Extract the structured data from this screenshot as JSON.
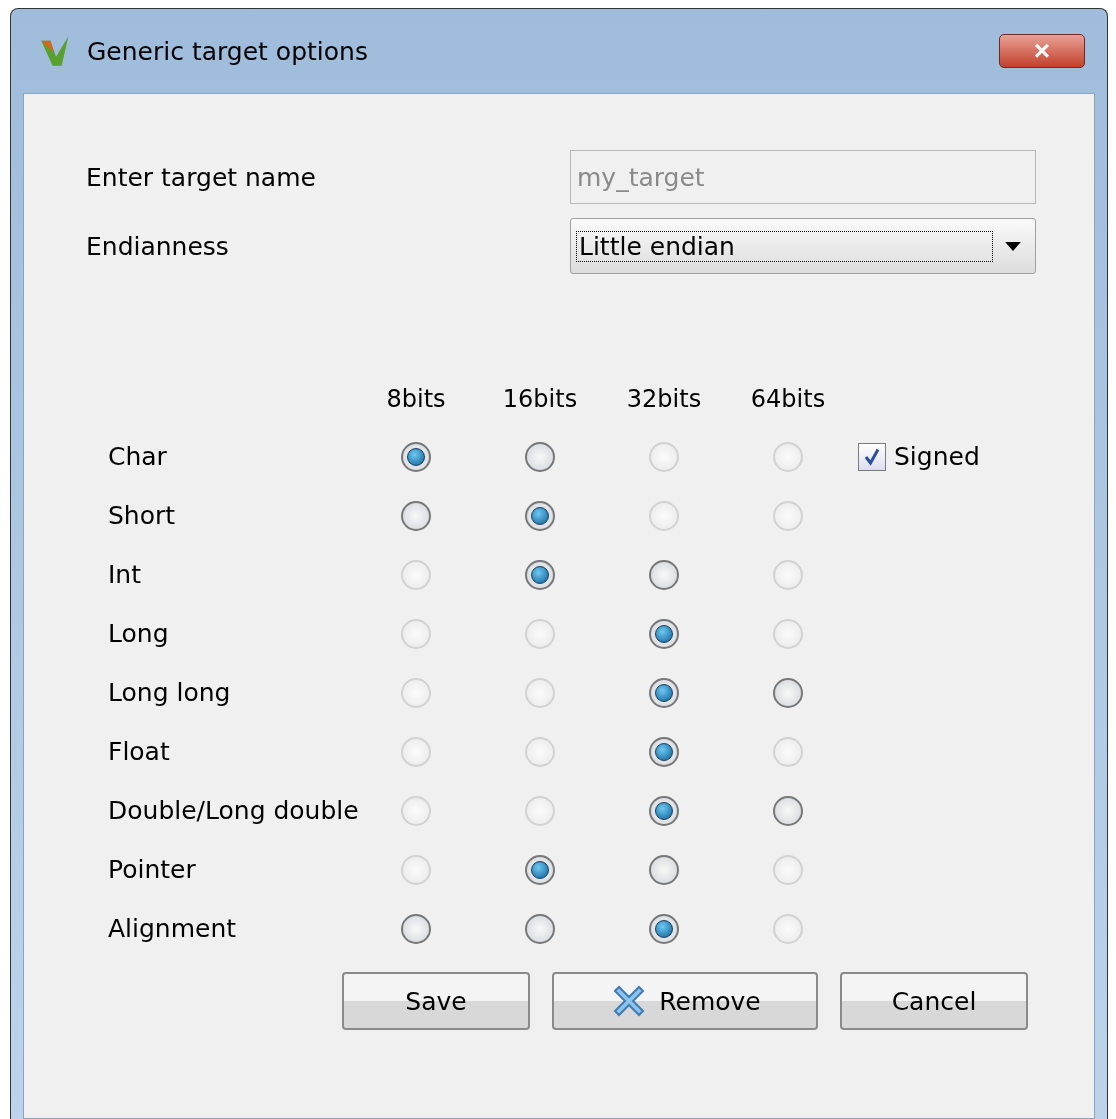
{
  "window": {
    "title": "Generic target options",
    "close_button": "×"
  },
  "target_name": {
    "label": "Enter target name",
    "placeholder": "my_target"
  },
  "endianness": {
    "label": "Endianness",
    "value": "Little endian"
  },
  "columns": [
    "8bits",
    "16bits",
    "32bits",
    "64bits"
  ],
  "signed": {
    "label": "Signed",
    "checked": true
  },
  "rows": [
    {
      "label": "Char",
      "options": [
        {
          "selected": true,
          "disabled": false
        },
        {
          "selected": false,
          "disabled": false
        },
        {
          "selected": false,
          "disabled": true
        },
        {
          "selected": false,
          "disabled": true
        }
      ]
    },
    {
      "label": "Short",
      "options": [
        {
          "selected": false,
          "disabled": false
        },
        {
          "selected": true,
          "disabled": false
        },
        {
          "selected": false,
          "disabled": true
        },
        {
          "selected": false,
          "disabled": true
        }
      ]
    },
    {
      "label": "Int",
      "options": [
        {
          "selected": false,
          "disabled": true
        },
        {
          "selected": true,
          "disabled": false
        },
        {
          "selected": false,
          "disabled": false
        },
        {
          "selected": false,
          "disabled": true
        }
      ]
    },
    {
      "label": "Long",
      "options": [
        {
          "selected": false,
          "disabled": true
        },
        {
          "selected": false,
          "disabled": true
        },
        {
          "selected": true,
          "disabled": false
        },
        {
          "selected": false,
          "disabled": true
        }
      ]
    },
    {
      "label": "Long long",
      "options": [
        {
          "selected": false,
          "disabled": true
        },
        {
          "selected": false,
          "disabled": true
        },
        {
          "selected": true,
          "disabled": false
        },
        {
          "selected": false,
          "disabled": false
        }
      ]
    },
    {
      "label": "Float",
      "options": [
        {
          "selected": false,
          "disabled": true
        },
        {
          "selected": false,
          "disabled": true
        },
        {
          "selected": true,
          "disabled": false
        },
        {
          "selected": false,
          "disabled": true
        }
      ]
    },
    {
      "label": "Double/Long double",
      "options": [
        {
          "selected": false,
          "disabled": true
        },
        {
          "selected": false,
          "disabled": true
        },
        {
          "selected": true,
          "disabled": false
        },
        {
          "selected": false,
          "disabled": false
        }
      ]
    },
    {
      "label": "Pointer",
      "options": [
        {
          "selected": false,
          "disabled": true
        },
        {
          "selected": true,
          "disabled": false
        },
        {
          "selected": false,
          "disabled": false
        },
        {
          "selected": false,
          "disabled": true
        }
      ]
    },
    {
      "label": "Alignment",
      "options": [
        {
          "selected": false,
          "disabled": false
        },
        {
          "selected": false,
          "disabled": false
        },
        {
          "selected": true,
          "disabled": false
        },
        {
          "selected": false,
          "disabled": true
        }
      ]
    }
  ],
  "buttons": [
    {
      "label": "Save",
      "kind": "plain"
    },
    {
      "label": "Remove",
      "kind": "remove"
    },
    {
      "label": "Cancel",
      "kind": "plain"
    }
  ]
}
